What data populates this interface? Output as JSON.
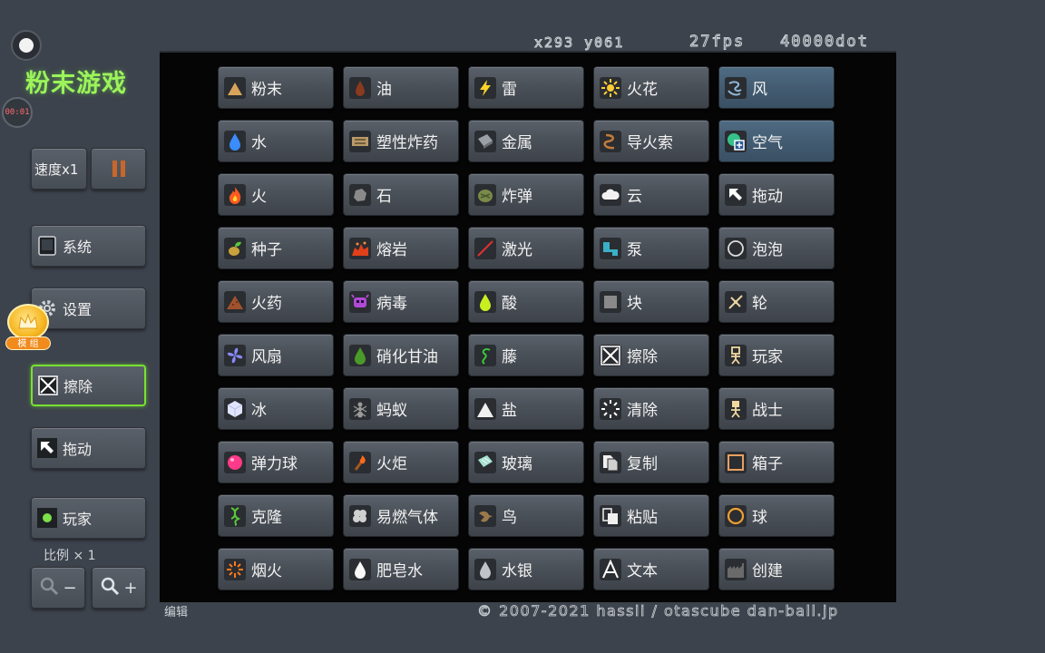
{
  "app": {
    "title": "粉末游戏",
    "timer": "00:01"
  },
  "status": {
    "coords": "x293 y061",
    "fps": "27fps",
    "dots": "40000dot"
  },
  "sidebar": {
    "speed_label": "速度x1",
    "system_label": "系统",
    "settings_label": "设置",
    "mod_badge_label": "模 组",
    "erase_label": "擦除",
    "drag_label": "拖动",
    "player_label": "玩家",
    "scale_label": "比例 × 1",
    "zoom_out_label": "−",
    "zoom_in_label": "+"
  },
  "elements": [
    {
      "label": "粉末",
      "icon": "powder-icon",
      "color": "#d9a45a"
    },
    {
      "label": "油",
      "icon": "oil-icon",
      "color": "#8a3a1f"
    },
    {
      "label": "雷",
      "icon": "thunder-icon",
      "color": "#ffd42a"
    },
    {
      "label": "火花",
      "icon": "spark-icon",
      "color": "#ffcc33"
    },
    {
      "label": "风",
      "icon": "wind-icon",
      "color": "#8fb7d9",
      "highlight": true
    },
    {
      "label": "水",
      "icon": "water-icon",
      "color": "#3a8cff"
    },
    {
      "label": "塑性炸药",
      "icon": "c4-icon",
      "color": "#b89a6a"
    },
    {
      "label": "金属",
      "icon": "metal-icon",
      "color": "#9aa0a6"
    },
    {
      "label": "导火索",
      "icon": "fuse-icon",
      "color": "#c07a3a"
    },
    {
      "label": "空气",
      "icon": "air-icon",
      "color": "#35c28a",
      "highlight": true
    },
    {
      "label": "火",
      "icon": "fire-icon",
      "color": "#ff5a1f"
    },
    {
      "label": "石",
      "icon": "stone-icon",
      "color": "#8a8a8a"
    },
    {
      "label": "炸弹",
      "icon": "bomb-icon",
      "color": "#7a8a4a"
    },
    {
      "label": "云",
      "icon": "cloud-icon",
      "color": "#f2f2f2"
    },
    {
      "label": "拖动",
      "icon": "drag-arrow-icon",
      "color": "#ffffff"
    },
    {
      "label": "种子",
      "icon": "seed-icon",
      "color": "#c8a23a"
    },
    {
      "label": "熔岩",
      "icon": "lava-icon",
      "color": "#e0401a"
    },
    {
      "label": "激光",
      "icon": "laser-icon",
      "color": "#e03030"
    },
    {
      "label": "泵",
      "icon": "pump-icon",
      "color": "#3ab0c8"
    },
    {
      "label": "泡泡",
      "icon": "bubble-icon",
      "color": "#dcdcdc"
    },
    {
      "label": "火药",
      "icon": "gunpowder-icon",
      "color": "#a0522d"
    },
    {
      "label": "病毒",
      "icon": "virus-icon",
      "color": "#b04ad8"
    },
    {
      "label": "酸",
      "icon": "acid-icon",
      "color": "#c8f020"
    },
    {
      "label": "块",
      "icon": "block-icon",
      "color": "#8a8a8a"
    },
    {
      "label": "轮",
      "icon": "wheel-icon",
      "color": "#e8d4a0"
    },
    {
      "label": "风扇",
      "icon": "fan-icon",
      "color": "#8a8aff"
    },
    {
      "label": "硝化甘油",
      "icon": "nitro-icon",
      "color": "#4a9a2a"
    },
    {
      "label": "藤",
      "icon": "vine-icon",
      "color": "#3ac83a"
    },
    {
      "label": "擦除",
      "icon": "erase-icon",
      "color": "#ffffff"
    },
    {
      "label": "玩家",
      "icon": "player-icon",
      "color": "#f0d8a0"
    },
    {
      "label": "冰",
      "icon": "ice-icon",
      "color": "#e0e4ff"
    },
    {
      "label": "蚂蚁",
      "icon": "ant-icon",
      "color": "#9a9a9a"
    },
    {
      "label": "盐",
      "icon": "salt-icon",
      "color": "#f0f0f0"
    },
    {
      "label": "清除",
      "icon": "clear-icon",
      "color": "#ffffff"
    },
    {
      "label": "战士",
      "icon": "fighter-icon",
      "color": "#f0d8a0"
    },
    {
      "label": "弹力球",
      "icon": "ball-icon",
      "color": "#ff3a8a"
    },
    {
      "label": "火炬",
      "icon": "torch-icon",
      "color": "#ff6a1a"
    },
    {
      "label": "玻璃",
      "icon": "glass-icon",
      "color": "#a8e0d0"
    },
    {
      "label": "复制",
      "icon": "copy-icon",
      "color": "#f0f0f0"
    },
    {
      "label": "箱子",
      "icon": "box-icon",
      "color": "#e8a060"
    },
    {
      "label": "克隆",
      "icon": "clone-icon",
      "color": "#5ac83a"
    },
    {
      "label": "易燃气体",
      "icon": "gas-icon",
      "color": "#d0d0d0"
    },
    {
      "label": "鸟",
      "icon": "bird-icon",
      "color": "#9a7a4a"
    },
    {
      "label": "粘贴",
      "icon": "paste-icon",
      "color": "#f0f0f0"
    },
    {
      "label": "球",
      "icon": "sphere-icon",
      "color": "#f0a030"
    },
    {
      "label": "烟火",
      "icon": "firework-icon",
      "color": "#ff7a1a"
    },
    {
      "label": "肥皂水",
      "icon": "soap-icon",
      "color": "#f8f8f8"
    },
    {
      "label": "水银",
      "icon": "mercury-icon",
      "color": "#c0c4c8"
    },
    {
      "label": "文本",
      "icon": "text-icon",
      "color": "#ffffff"
    },
    {
      "label": "创建",
      "icon": "create-icon",
      "color": "#6a6a6a"
    }
  ],
  "footer": {
    "edit_label": "编辑",
    "copyright": "© 2007-2021 hassii / otascube dan-ball.jp"
  }
}
